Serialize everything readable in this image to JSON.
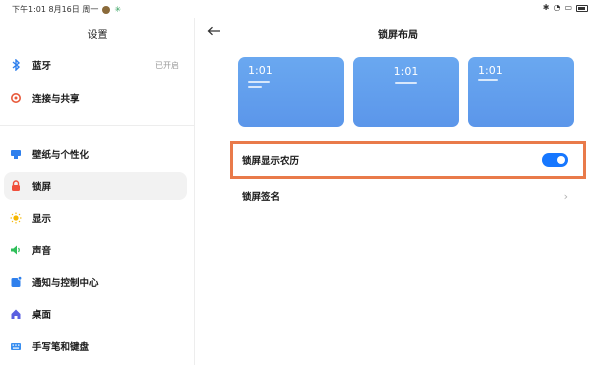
{
  "status_bar": {
    "time_date": "下午1:01  8月16日 周一"
  },
  "sidebar": {
    "title": "设置",
    "items": [
      {
        "label": "蓝牙",
        "state": "已开启",
        "icon": "bluetooth-icon",
        "color": "#2f80ed"
      },
      {
        "label": "连接与共享",
        "state": "",
        "icon": "share-icon",
        "color": "#e8593a"
      },
      {
        "label": "壁纸与个性化",
        "state": "",
        "icon": "wallpaper-icon",
        "color": "#2f80ed"
      },
      {
        "label": "锁屏",
        "state": "",
        "icon": "lock-icon",
        "color": "#f0503c"
      },
      {
        "label": "显示",
        "state": "",
        "icon": "sun-icon",
        "color": "#f5b700"
      },
      {
        "label": "声音",
        "state": "",
        "icon": "speaker-icon",
        "color": "#2fbf5a"
      },
      {
        "label": "通知与控制中心",
        "state": "",
        "icon": "notification-icon",
        "color": "#2f80ed"
      },
      {
        "label": "桌面",
        "state": "",
        "icon": "home-icon",
        "color": "#5a5fe0"
      },
      {
        "label": "手写笔和键盘",
        "state": "",
        "icon": "keyboard-icon",
        "color": "#3a8ff0"
      }
    ]
  },
  "main": {
    "title": "锁屏布局",
    "previews": [
      {
        "time": "1:01",
        "style": "left"
      },
      {
        "time": "1:01",
        "style": "center"
      },
      {
        "time": "1:01",
        "style": "left-small"
      }
    ],
    "settings": [
      {
        "label": "锁屏显示农历",
        "control": "toggle",
        "value": true
      },
      {
        "label": "锁屏签名",
        "control": "chevron"
      }
    ]
  },
  "colors": {
    "accent": "#1677ff",
    "highlight": "#e97a4a",
    "preview_bg": "#6aa8f0"
  }
}
